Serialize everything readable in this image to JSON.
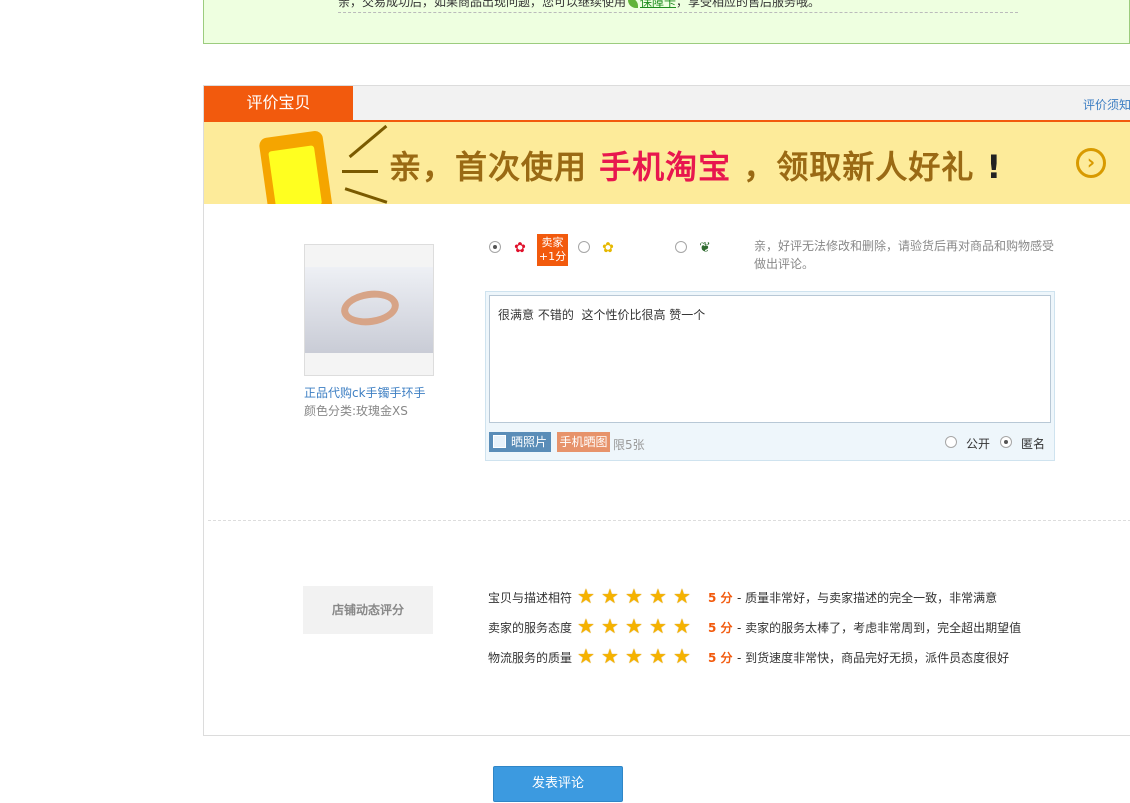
{
  "notice": {
    "text_prefix": "亲，交易成功后，如果商品出现问题，您可以继续使用",
    "link": "保障卡",
    "text_suffix": "，享受相应的售后服务哦。"
  },
  "review": {
    "tab_label": "评价宝贝",
    "help_link": "评价须知",
    "banner": {
      "prefix": "亲，首次使用",
      "highlight": "手机淘宝",
      "suffix": "，领取新人好礼",
      "exclaim": "!",
      "arrow": "›"
    },
    "product": {
      "name": "正品代购ck手镯手环手",
      "sku": "颜色分类:玫瑰金XS"
    },
    "rating": {
      "seller_badge_line1": "卖家",
      "seller_badge_line2": "+1分",
      "tip": "亲，好评无法修改和删除，请验货后再对商品和购物感受做出评论。"
    },
    "textarea_value": "很满意 不错的  这个性价比很高 赞一个",
    "photo_button": "晒照片",
    "mobile_button": "手机晒图",
    "limit": "限5张",
    "visibility": {
      "public": "公开",
      "anonymous": "匿名"
    }
  },
  "shop_rating": {
    "title": "店铺动态评分",
    "rows": [
      {
        "label": "宝贝与描述相符",
        "score": "5 分",
        "desc": "- 质量非常好，与卖家描述的完全一致，非常满意"
      },
      {
        "label": "卖家的服务态度",
        "score": "5 分",
        "desc": "- 卖家的服务太棒了，考虑非常周到，完全超出期望值"
      },
      {
        "label": "物流服务的质量",
        "score": "5 分",
        "desc": "- 到货速度非常快，商品完好无损，派件员态度很好"
      }
    ]
  },
  "submit_label": "发表评论",
  "colors": {
    "accent": "#f25a0d",
    "link": "#3e7fc3",
    "button": "#3c9ae0",
    "star": "#f5b200"
  },
  "icons": {
    "star": "star-icon",
    "good": "red-flower-icon",
    "neutral": "yellow-flower-icon",
    "bad": "dead-flower-icon"
  }
}
